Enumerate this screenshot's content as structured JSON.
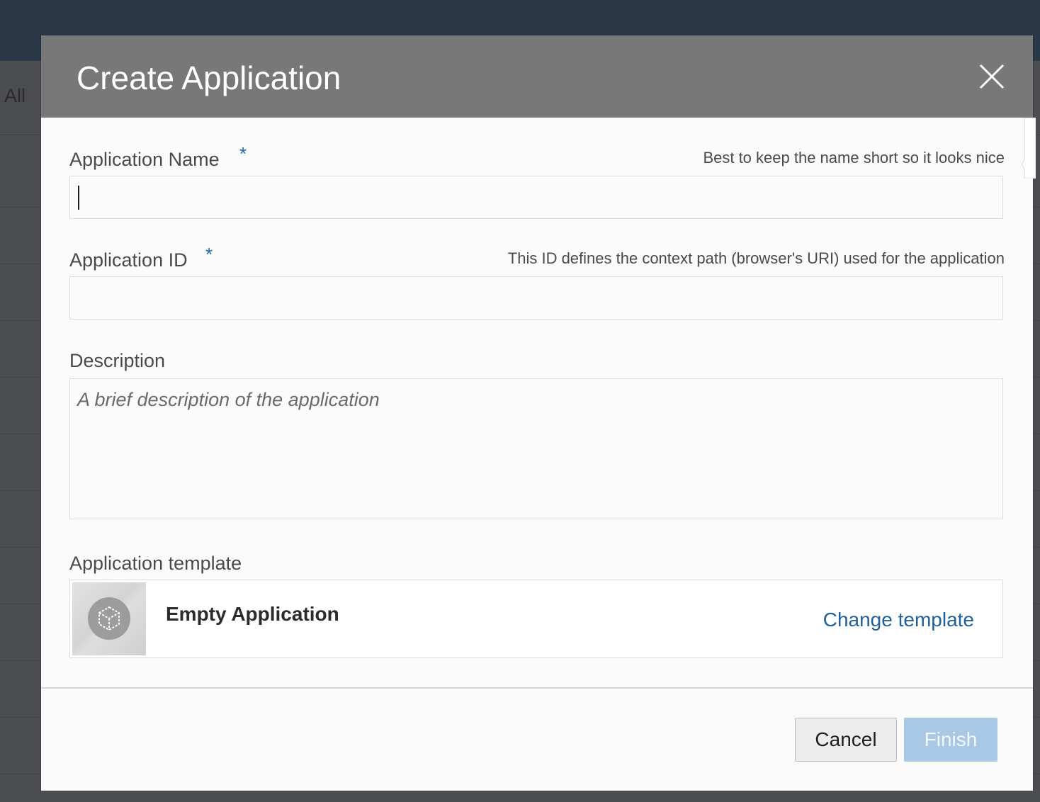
{
  "background": {
    "tab_all_label": "All"
  },
  "modal": {
    "title": "Create Application",
    "fields": {
      "app_name": {
        "label": "Application Name",
        "required_marker": "*",
        "help": "Best to keep the name short so it looks nice",
        "value": ""
      },
      "app_id": {
        "label": "Application ID",
        "required_marker": "*",
        "help": "This ID defines the context path (browser's URI) used for the application",
        "value": ""
      },
      "description": {
        "label": "Description",
        "placeholder": "A brief description of the application",
        "value": ""
      }
    },
    "template": {
      "label": "Application template",
      "name": "Empty Application",
      "change_link": "Change template",
      "icon": "cube-icon"
    },
    "footer": {
      "cancel_label": "Cancel",
      "finish_label": "Finish"
    }
  },
  "colors": {
    "header_bg": "#787878",
    "accent": "#1f67a6",
    "finish_disabled": "#a8c8e6",
    "topbar": "#2a3747"
  }
}
